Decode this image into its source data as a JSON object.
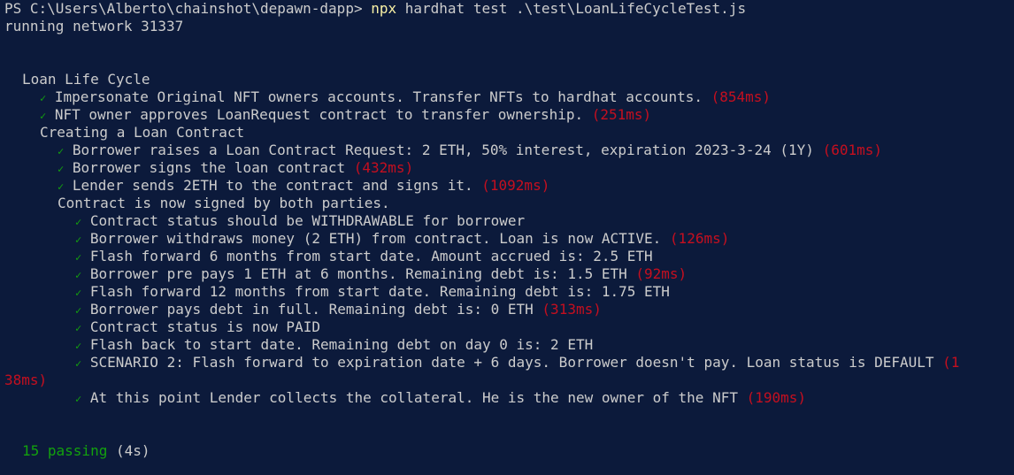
{
  "prompt": {
    "ps": "PS C:\\Users\\Alberto\\chainshot\\depawn-dapp> ",
    "command": "npx",
    "args": " hardhat test .\\test\\LoanLifeCycleTest.js"
  },
  "network_line": "running network 31337",
  "suite": {
    "title": "Loan Life Cycle",
    "check": "✓",
    "tests_top": [
      {
        "text": "Impersonate Original NFT owners accounts. Transfer NFTs to hardhat accounts.",
        "time": "(854ms)"
      },
      {
        "text": "NFT owner approves LoanRequest contract to transfer ownership.",
        "time": "(251ms)"
      }
    ],
    "creating": {
      "title": "Creating a Loan Contract",
      "tests": [
        {
          "text": "Borrower raises a Loan Contract Request: 2 ETH, 50% interest, expiration 2023-3-24 (1Y)",
          "time": "(601ms)"
        },
        {
          "text": "Borrower signs the loan contract",
          "time": "(432ms)"
        },
        {
          "text": "Lender sends 2ETH to the contract and signs it.",
          "time": "(1092ms)"
        }
      ],
      "signed": {
        "title": "Contract is now signed by both parties.",
        "tests": [
          {
            "text": "Contract status should be WITHDRAWABLE for borrower",
            "time": ""
          },
          {
            "text": "Borrower withdraws money (2 ETH) from contract. Loan is now ACTIVE.",
            "time": "(126ms)"
          },
          {
            "text": "Flash forward 6 months from start date. Amount accrued is: 2.5 ETH",
            "time": ""
          },
          {
            "text": "Borrower pre pays 1 ETH at 6 months. Remaining debt is: 1.5 ETH",
            "time": "(92ms)"
          },
          {
            "text": "Flash forward 12 months from start date. Remaining debt is: 1.75 ETH",
            "time": ""
          },
          {
            "text": "Borrower pays debt in full. Remaining debt is: 0 ETH",
            "time": "(313ms)"
          },
          {
            "text": "Contract status is now PAID",
            "time": ""
          },
          {
            "text": "Flash back to start date. Remaining debt on day 0 is: 2 ETH",
            "time": ""
          }
        ],
        "scenario": {
          "text": "SCENARIO 2: Flash forward to expiration date + 6 days. Borrower doesn't pay. Loan status is DEFAULT",
          "time_part1": "(1",
          "time_part2": "38ms)"
        },
        "last": {
          "text": "At this point Lender collects the collateral. He is the new owner of the NFT",
          "time": "(190ms)"
        }
      }
    }
  },
  "summary": {
    "passing": "15 passing",
    "duration": "(4s)"
  },
  "colors": {
    "background": "#0c1a3b",
    "text": "#cccccc",
    "command": "#f9f1a5",
    "time": "#c50f1f",
    "pass": "#13a10e"
  }
}
